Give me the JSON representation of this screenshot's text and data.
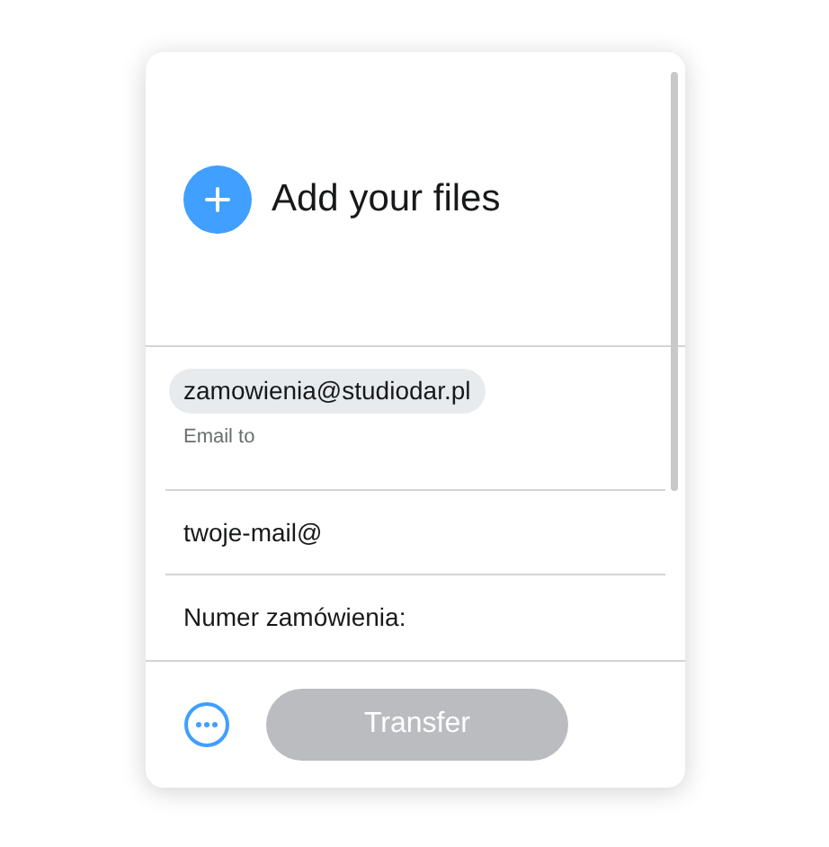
{
  "upload": {
    "label": "Add your files"
  },
  "recipient": {
    "chip": "zamowienia@studiodar.pl",
    "label": "Email to"
  },
  "fields": [
    {
      "value": "twoje-mail@"
    },
    {
      "value": "Numer zamówienia:"
    }
  ],
  "footer": {
    "button": {
      "label": "Transfer",
      "disabled": true
    }
  }
}
